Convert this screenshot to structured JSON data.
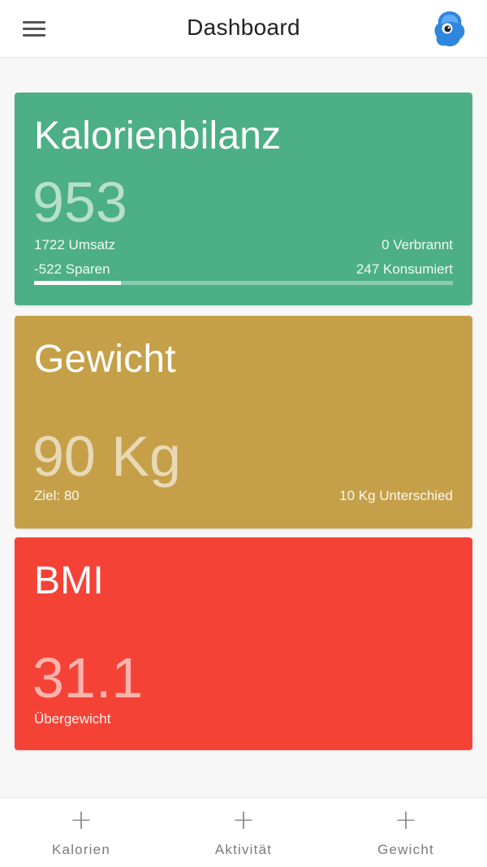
{
  "header": {
    "title": "Dashboard",
    "menu_icon": "hamburger-menu-icon",
    "logo_icon": "app-logo-icon"
  },
  "cards": {
    "kalorien": {
      "title": "Kalorienbilanz",
      "value": "953",
      "umsatz": "1722 Umsatz",
      "verbrannt": "0 Verbrannt",
      "sparen": "-522 Sparen",
      "konsumiert": "247 Konsumiert",
      "progress_fraction": 0.207,
      "color": "#4caf85"
    },
    "gewicht": {
      "title": "Gewicht",
      "value": "90 Kg",
      "ziel": "Ziel: 80",
      "unterschied": "10 Kg Unterschied",
      "color": "#c5a049"
    },
    "bmi": {
      "title": "BMI",
      "value": "31.1",
      "status": "Übergewicht",
      "color": "#f44336"
    }
  },
  "bottom_nav": {
    "items": [
      {
        "label": "Kalorien",
        "icon": "plus-icon"
      },
      {
        "label": "Aktivität",
        "icon": "plus-icon"
      },
      {
        "label": "Gewicht",
        "icon": "plus-icon"
      }
    ]
  }
}
